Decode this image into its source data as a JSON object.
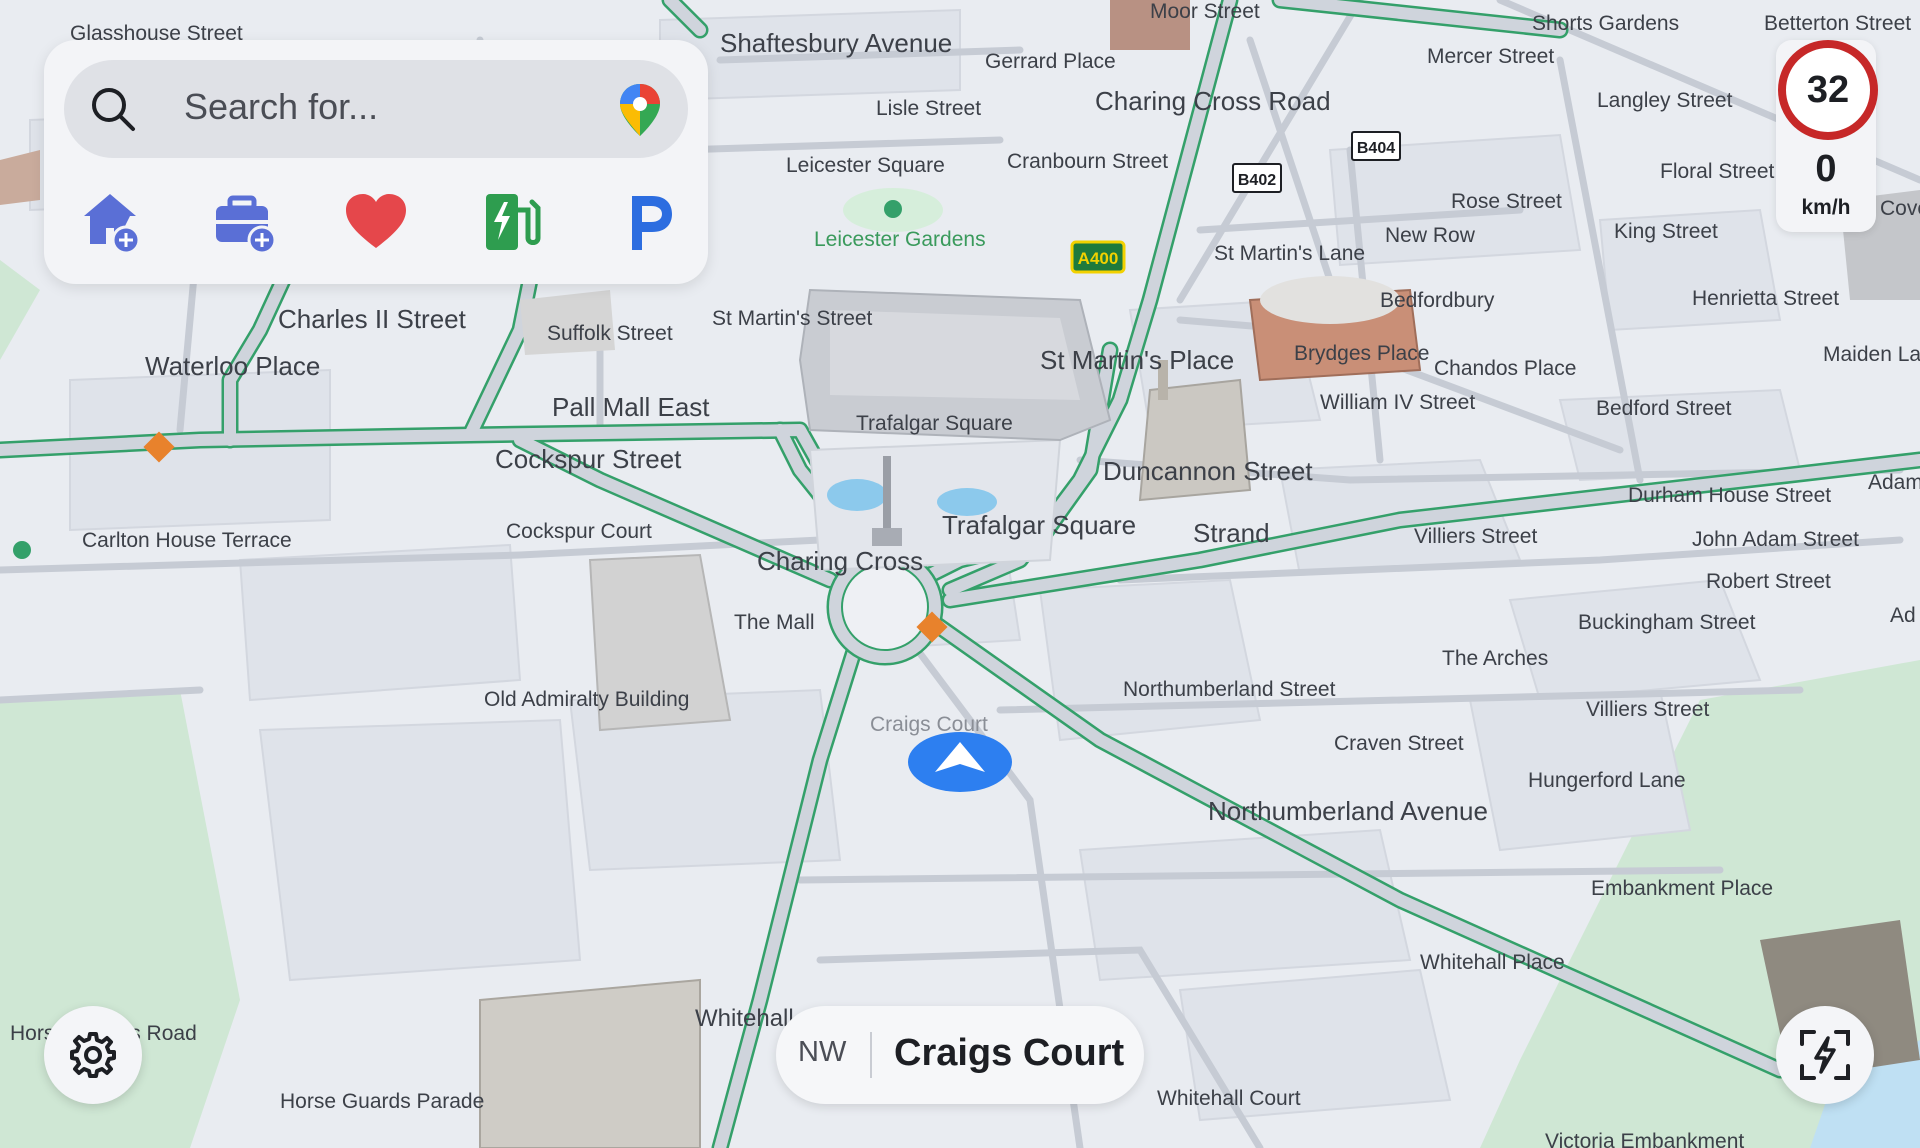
{
  "search": {
    "placeholder": "Search for..."
  },
  "shortcuts": [
    {
      "icon": "home-add-icon",
      "color": "#5a6fd6"
    },
    {
      "icon": "work-add-icon",
      "color": "#5a6fd6"
    },
    {
      "icon": "favorites-heart-icon",
      "color": "#e5474b"
    },
    {
      "icon": "ev-charging-icon",
      "color": "#2e9d4f"
    },
    {
      "icon": "parking-icon",
      "color": "#2c6de0"
    }
  ],
  "speed": {
    "limit": "32",
    "current": "0",
    "unit": "km/h"
  },
  "location": {
    "heading": "NW",
    "street": "Craigs Court"
  },
  "road_shields": [
    "A400",
    "B402",
    "B404"
  ],
  "map_labels": {
    "glasshouse_street": "Glasshouse Street",
    "shaftesbury_avenue": "Shaftesbury Avenue",
    "gerrard_place": "Gerrard Place",
    "moor_street": "Moor Street",
    "shorts_gardens": "Shorts Gardens",
    "betterton_street": "Betterton Street",
    "mercer_street": "Mercer Street",
    "charing_cross_road": "Charing Cross Road",
    "lisle_street": "Lisle Street",
    "langley_street": "Langley Street",
    "leicester_square": "Leicester Square",
    "cranbourn_street": "Cranbourn Street",
    "floral_street": "Floral Street",
    "rose_street": "Rose Street",
    "leicester_gardens": "Leicester Gardens",
    "new_row": "New Row",
    "king_street": "King Street",
    "st_martins_lane": "St Martin's Lane",
    "henrietta_street": "Henrietta Street",
    "bedfordbury": "Bedfordbury",
    "charles_ii_street": "Charles II Street",
    "suffolk_street": "Suffolk Street",
    "st_martins_street": "St Martin's Street",
    "brydges_place": "Brydges Place",
    "maiden_lane": "Maiden Lane",
    "waterloo_place": "Waterloo Place",
    "st_martins_place": "St Martin's Place",
    "chandos_place": "Chandos Place",
    "william_iv_street": "William IV Street",
    "bedford_street": "Bedford Street",
    "pall_mall_east": "Pall Mall East",
    "trafalgar_square_top": "Trafalgar Square",
    "cockspur_street": "Cockspur Street",
    "duncannon_street": "Duncannon Street",
    "durham_house_street": "Durham House Street",
    "trafalgar_square": "Trafalgar Square",
    "strand": "Strand",
    "villiers_street_top": "Villiers Street",
    "john_adam_street": "John Adam Street",
    "cockspur_court": "Cockspur Court",
    "carlton_house_terrace": "Carlton House Terrace",
    "charing_cross": "Charing Cross",
    "robert_street": "Robert Street",
    "the_mall": "The Mall",
    "buckingham_street": "Buckingham Street",
    "the_arches": "The Arches",
    "northumberland_street": "Northumberland Street",
    "old_admiralty_building": "Old Admiralty Building",
    "villiers_street": "Villiers Street",
    "craigs_court_map": "Craigs Court",
    "craven_street": "Craven Street",
    "hungerford_lane": "Hungerford Lane",
    "northumberland_avenue": "Northumberland Avenue",
    "embankment_place": "Embankment Place",
    "whitehall_place": "Whitehall Place",
    "whitehall": "Whitehall",
    "horse_guards_road": "Horse Guards Road",
    "horse_guards_parade": "Horse Guards Parade",
    "whitehall_court": "Whitehall Court",
    "victoria_embankment": "Victoria Embankment",
    "adam": "Adam",
    "ad": "Ad",
    "covent": "Covent"
  }
}
